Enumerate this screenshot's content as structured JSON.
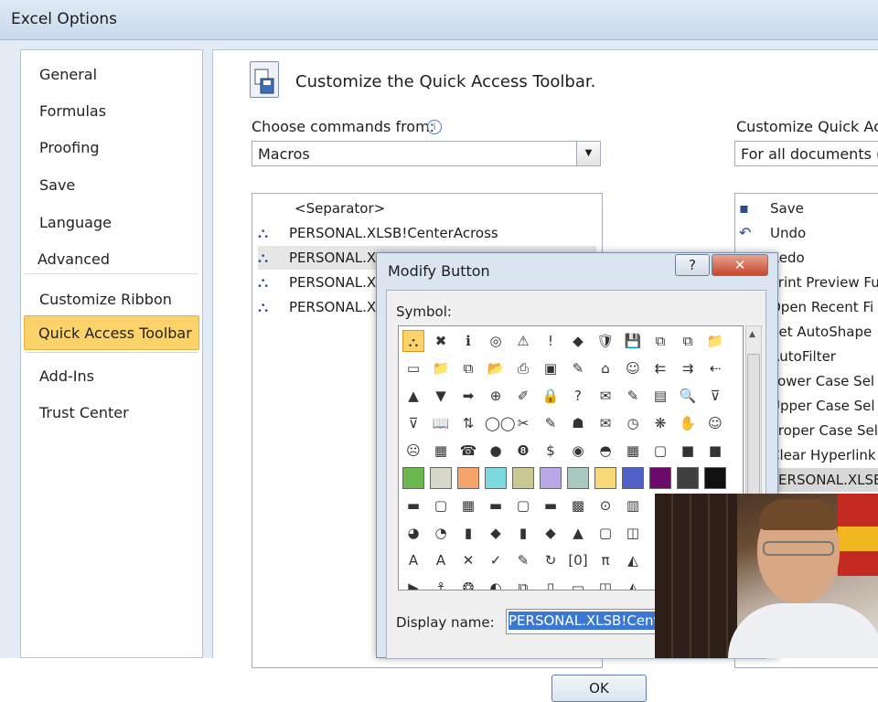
{
  "window": {
    "title": "Excel Options"
  },
  "sidebar": {
    "items": [
      {
        "label": "General"
      },
      {
        "label": "Formulas"
      },
      {
        "label": "Proofing"
      },
      {
        "label": "Save"
      },
      {
        "label": "Language"
      },
      {
        "label": "Advanced"
      },
      {
        "label": "Customize Ribbon"
      },
      {
        "label": "Quick Access Toolbar",
        "selected": true
      },
      {
        "label": "Add-Ins"
      },
      {
        "label": "Trust Center"
      }
    ]
  },
  "main": {
    "heading": "Customize the Quick Access Toolbar.",
    "choose_label": "Choose commands from:",
    "choose_value": "Macros",
    "customize_label": "Customize Quick Acc",
    "customize_value": "For all documents (d",
    "commands": [
      {
        "label": "<Separator>"
      },
      {
        "label": "PERSONAL.XLSB!CenterAcross"
      },
      {
        "label": "PERSONAL.XLSB",
        "highlighted": true
      },
      {
        "label": "PERSONAL.XLSB"
      },
      {
        "label": "PERSONAL.XLSB"
      }
    ],
    "toolbar_items": [
      {
        "label": "Save"
      },
      {
        "label": "Undo"
      },
      {
        "label": "Redo"
      },
      {
        "label": "Print Preview Fu"
      },
      {
        "label": "Open Recent Fi"
      },
      {
        "label": "Set AutoShape"
      },
      {
        "label": "AutoFilter"
      },
      {
        "label": "Lower Case Sel"
      },
      {
        "label": "Upper Case Sel"
      },
      {
        "label": "Proper Case Sel"
      },
      {
        "label": "Clear Hyperlink"
      },
      {
        "label": "PERSONAL.XLSB",
        "selected": true
      }
    ]
  },
  "dialog": {
    "title": "Modify Button",
    "help": "?",
    "close": "✕",
    "symbol_label": "Symbol:",
    "display_name_label": "Display name:",
    "display_name_value": "PERSONAL.XLSB!Cente",
    "ok": "OK"
  },
  "symbols": [
    "⛬",
    "✖",
    "ℹ",
    "◎",
    "⚠",
    "!",
    "◆",
    "🛡",
    "💾",
    "⧉",
    "⧉",
    "📁",
    "▭",
    "📁",
    "⧉",
    "📂",
    "⎙",
    "▣",
    "✎",
    "⌂",
    "☺",
    "⇇",
    "⇉",
    "⇠",
    "▲",
    "▼",
    "➡",
    "⊕",
    "✐",
    "🔒",
    "?",
    "✉",
    "✎",
    "▤",
    "🔍",
    "⊽",
    "⊽",
    "📖",
    "⇅",
    "◯◯",
    "✂",
    "✎",
    "☗",
    "✉",
    "◷",
    "❋",
    "✋",
    "☺",
    "☹",
    "▦",
    "☎",
    "●",
    "❽",
    "$",
    "◉",
    "◓",
    "▦",
    "▢",
    "■",
    "■",
    "■",
    "■",
    "■",
    "■",
    "■",
    "■",
    "■",
    "■",
    "◪",
    "■",
    "◩",
    "■",
    "▬",
    "▢",
    "▦",
    "▬",
    "▢",
    "▬",
    "▩",
    "⊙",
    "▥",
    "◢",
    "",
    "",
    "◕",
    "◔",
    "▮",
    "◆",
    "▮",
    "◆",
    "▲",
    "▢",
    "◫",
    "◉",
    "",
    "",
    "A",
    "A",
    "✕",
    "✓",
    "✎",
    "↻",
    "[0]",
    "π",
    "◭",
    "⚓",
    "",
    "",
    "▶",
    "⚓",
    "❂",
    "◐",
    "⧉",
    "▯",
    "▭",
    "◫",
    "◭",
    "⊿",
    "",
    ""
  ],
  "symbol_colors": {
    "accent": "#fbd36a",
    "swatches": [
      "#6bb84f",
      "#d8d8c8",
      "#f4a36a",
      "#7dd8e0",
      "#c8c890",
      "#b8a8e8",
      "#a8c8c0",
      "#f8d878",
      "#5060c8",
      "#6a0a6a",
      "#404040",
      "#101010"
    ]
  }
}
